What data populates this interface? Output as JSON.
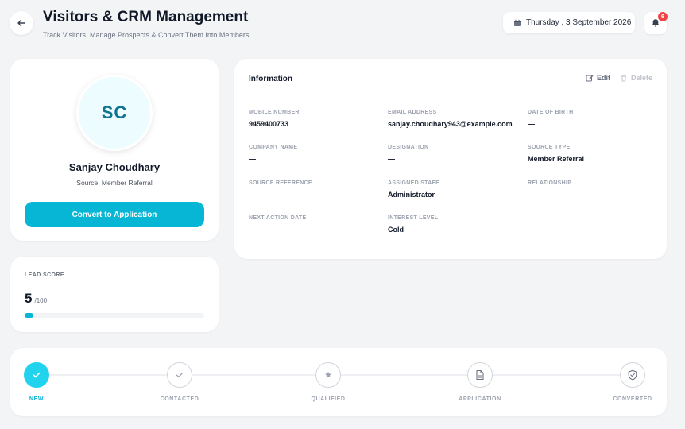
{
  "header": {
    "title": "Visitors & CRM Management",
    "subtitle": "Track Visitors, Manage Prospects & Convert Them Into Members",
    "date": "Thursday , 3 September 2026",
    "notification_count": "6"
  },
  "profile": {
    "initials": "SC",
    "name": "Sanjay Choudhary",
    "source": "Source: Member Referral",
    "convert_label": "Convert to Application"
  },
  "info": {
    "title": "Information",
    "edit_label": "Edit",
    "delete_label": "Delete",
    "fields": [
      {
        "label": "MOBILE NUMBER",
        "value": "9459400733"
      },
      {
        "label": "EMAIL ADDRESS",
        "value": "sanjay.choudhary943@example.com"
      },
      {
        "label": "DATE OF BIRTH",
        "value": "—"
      },
      {
        "label": "COMPANY NAME",
        "value": "—"
      },
      {
        "label": "DESIGNATION",
        "value": "—"
      },
      {
        "label": "SOURCE TYPE",
        "value": "Member Referral"
      },
      {
        "label": "SOURCE REFERENCE",
        "value": "—"
      },
      {
        "label": "ASSIGNED STAFF",
        "value": "Administrator"
      },
      {
        "label": "RELATIONSHIP",
        "value": "—"
      },
      {
        "label": "NEXT ACTION DATE",
        "value": "—"
      },
      {
        "label": "INTEREST LEVEL",
        "value": "Cold"
      }
    ]
  },
  "lead": {
    "label": "LEAD SCORE",
    "score": "5",
    "max": "/100",
    "progress_fraction": 0.05
  },
  "pipeline": {
    "stages": [
      {
        "label": "NEW",
        "icon": "check-icon",
        "active": true
      },
      {
        "label": "CONTACTED",
        "icon": "check-icon",
        "active": false
      },
      {
        "label": "QUALIFIED",
        "icon": "star-icon",
        "active": false
      },
      {
        "label": "APPLICATION",
        "icon": "document-icon",
        "active": false
      },
      {
        "label": "CONVERTED",
        "icon": "shield-check-icon",
        "active": false
      }
    ]
  },
  "colors": {
    "accent": "#06b6d4",
    "badge": "#ef4444",
    "avatar_bg": "#ecfcff"
  }
}
